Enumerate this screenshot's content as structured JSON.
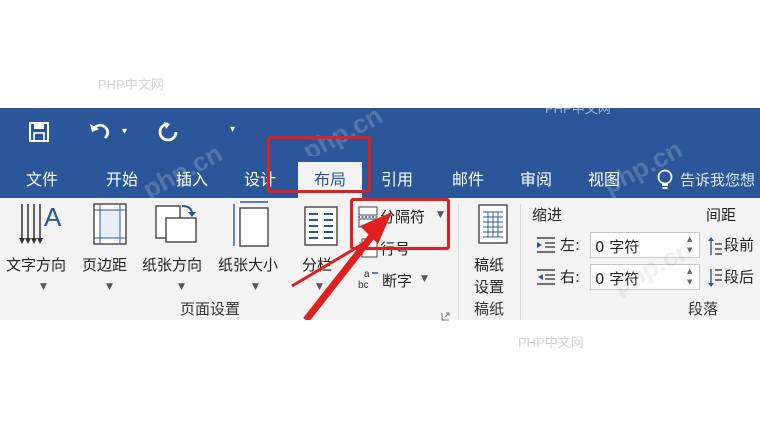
{
  "watermarks": [
    "PHP中文网",
    "PHP中文网",
    "PHP中文网",
    "php.cn",
    "php.cn",
    "php.cn",
    "php.cn"
  ],
  "quick_access": {
    "save_icon": "save-icon",
    "undo_icon": "undo-icon",
    "dropdown_glyph": "▾",
    "redo_icon": "redo-icon",
    "customize_glyph": "▾"
  },
  "tabs": [
    {
      "label": "文件"
    },
    {
      "label": "开始"
    },
    {
      "label": "插入"
    },
    {
      "label": "设计"
    },
    {
      "label": "布局",
      "active": true
    },
    {
      "label": "引用"
    },
    {
      "label": "邮件"
    },
    {
      "label": "审阅"
    },
    {
      "label": "视图"
    }
  ],
  "tell_me": "告诉我您想",
  "page_setup": {
    "text_direction": "文字方向",
    "margins": "页边距",
    "orientation": "纸张方向",
    "size": "纸张大小",
    "columns": "分栏",
    "breaks": "分隔符",
    "line_numbers": "行号",
    "hyphenation": "断字",
    "group_label": "页面设置"
  },
  "manuscript": {
    "label_line1": "稿纸",
    "label_line2": "设置",
    "group_label": "稿纸"
  },
  "paragraph": {
    "indent_header": "缩进",
    "spacing_header": "间距",
    "left_label": "左:",
    "right_label": "右:",
    "left_value": "0 字符",
    "right_value": "0 字符",
    "before_label": "段前",
    "after_label": "段后",
    "group_label": "段落"
  },
  "colors": {
    "accent": "#2b579a",
    "highlight": "#e02020",
    "ribbon_bg": "#f3f3f3"
  }
}
